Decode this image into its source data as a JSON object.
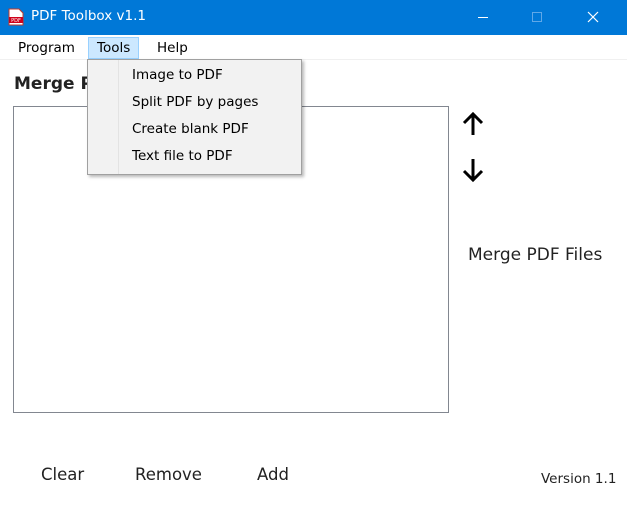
{
  "window": {
    "title": "PDF Toolbox v1.1",
    "accent_color": "#0078d7",
    "icons": [
      "pdf-app-icon",
      "minimize-icon",
      "maximize-icon",
      "close-icon"
    ]
  },
  "menubar": {
    "items": [
      {
        "label": "Program"
      },
      {
        "label": "Tools",
        "open": true
      },
      {
        "label": "Help"
      }
    ]
  },
  "tools_menu": {
    "items": [
      {
        "label": "Image to PDF"
      },
      {
        "label": "Split PDF by pages"
      },
      {
        "label": "Create blank PDF"
      },
      {
        "label": "Text file to PDF"
      }
    ]
  },
  "main": {
    "section_title": "Merge P",
    "file_list": [],
    "merge_label": "Merge PDF Files",
    "icons": [
      "arrow-up-icon",
      "arrow-down-icon"
    ]
  },
  "footer": {
    "clear_label": "Clear",
    "remove_label": "Remove",
    "add_label": "Add",
    "version_text": "Version 1.1"
  }
}
